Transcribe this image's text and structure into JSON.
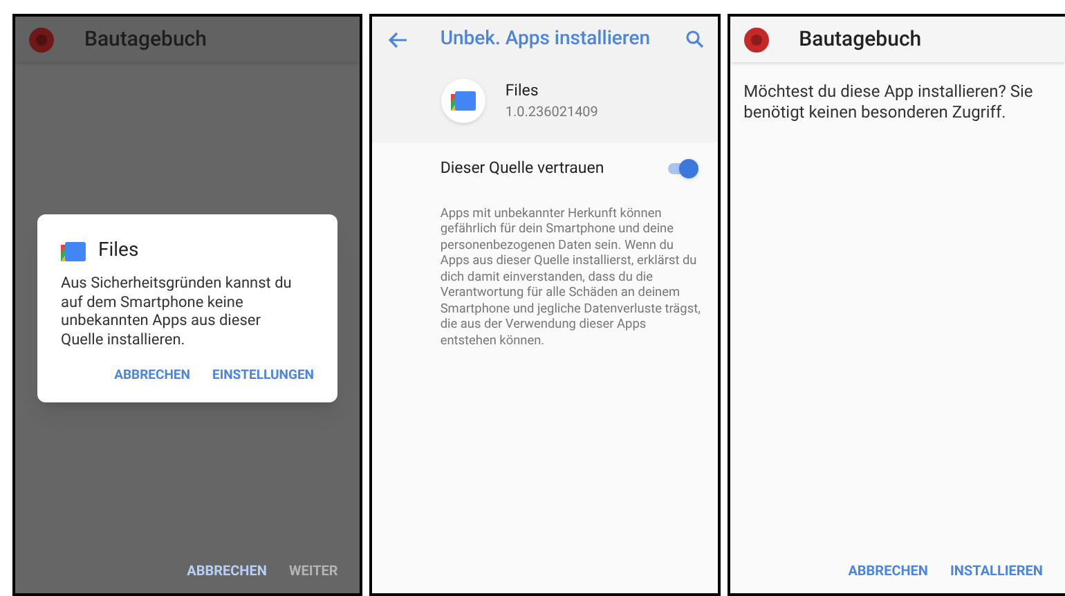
{
  "panels": [
    {
      "kind": "blocked",
      "app_bar": {
        "title": "Bautagebuch"
      },
      "dialog": {
        "title": "Files",
        "message": "Aus Sicherheitsgründen kannst du auf dem Smartphone keine unbekannten Apps aus dieser Quelle installieren.",
        "buttons": [
          "ABBRECHEN",
          "EINSTELLUNGEN"
        ]
      },
      "buttons": [
        {
          "label": "ABBRECHEN",
          "disabled": false
        },
        {
          "label": "WEITER",
          "disabled": true
        }
      ]
    },
    {
      "kind": "settings",
      "app_bar": {
        "title": "Unbek. Apps installieren"
      },
      "app": {
        "name": "Files",
        "version": "1.0.236021409"
      },
      "toggle": {
        "label": "Dieser Quelle vertrauen",
        "on": true
      },
      "description": "Apps mit unbekannter Herkunft können gefährlich für dein Smartphone und deine personenbezogenen Daten sein. Wenn du Apps aus dieser Quelle installierst, erklärst du dich damit einverstanden, dass du die Verantwortung für alle Schäden an deinem Smartphone und jegliche Datenverluste trägst, die aus der Verwendung dieser Apps entstehen können."
    },
    {
      "kind": "install",
      "app_bar": {
        "title": "Bautagebuch"
      },
      "message": "Möchtest du diese App installieren? Sie benötigt keinen besonderen Zugriff.",
      "buttons": [
        {
          "label": "ABBRECHEN",
          "disabled": false
        },
        {
          "label": "INSTALLIEREN",
          "disabled": false
        }
      ]
    }
  ]
}
